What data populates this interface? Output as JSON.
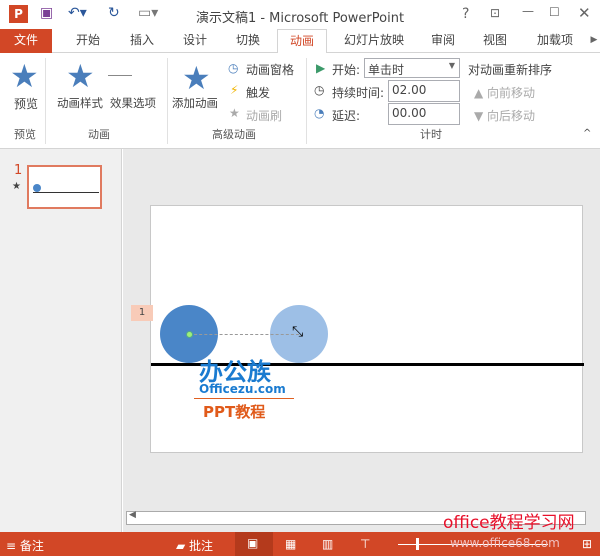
{
  "window": {
    "title": "演示文稿1 - Microsoft PowerPoint",
    "app_icon": "P",
    "help": "?",
    "controls": [
      "restore-ribbon",
      "minimize",
      "maximize",
      "close"
    ]
  },
  "quick_access": {
    "save": "save-icon",
    "undo": "undo-icon",
    "redo": "repeat-icon",
    "present": "present-icon"
  },
  "tabs": [
    {
      "label": "文件"
    },
    {
      "label": "开始"
    },
    {
      "label": "插入"
    },
    {
      "label": "设计"
    },
    {
      "label": "切换"
    },
    {
      "label": "动画",
      "active": true
    },
    {
      "label": "幻灯片放映"
    },
    {
      "label": "审阅"
    },
    {
      "label": "视图"
    },
    {
      "label": "加载项"
    }
  ],
  "ribbon": {
    "preview": {
      "button": "预览",
      "group": "预览"
    },
    "animation": {
      "styles": "动画样式",
      "effects": "效果选项",
      "group": "动画"
    },
    "advanced": {
      "add": "添加动画",
      "pane": "动画窗格",
      "trigger": "触发",
      "painter": "动画刷",
      "group": "高级动画"
    },
    "timing": {
      "start_label": "开始:",
      "start_value": "单击时",
      "duration_label": "持续时间:",
      "duration_value": "02.00",
      "delay_label": "延迟:",
      "delay_value": "00.00",
      "reorder": "对动画重新排序",
      "forward": "向前移动",
      "backward": "向后移动",
      "group": "计时"
    }
  },
  "thumbnails": [
    {
      "number": "1",
      "star": "★"
    }
  ],
  "slide": {
    "anim_tag": "1",
    "logo_cn": "办公族",
    "logo_url": "Officezu.com",
    "logo_sub": "PPT教程"
  },
  "status": {
    "notes": "备注",
    "comments": "批注"
  },
  "watermark": {
    "line1": "office教程学习网",
    "line2": "www.office68.com"
  },
  "colors": {
    "accent": "#d24726",
    "shape": "#4a86c8",
    "shape_ghost": "#9dbfe6"
  }
}
